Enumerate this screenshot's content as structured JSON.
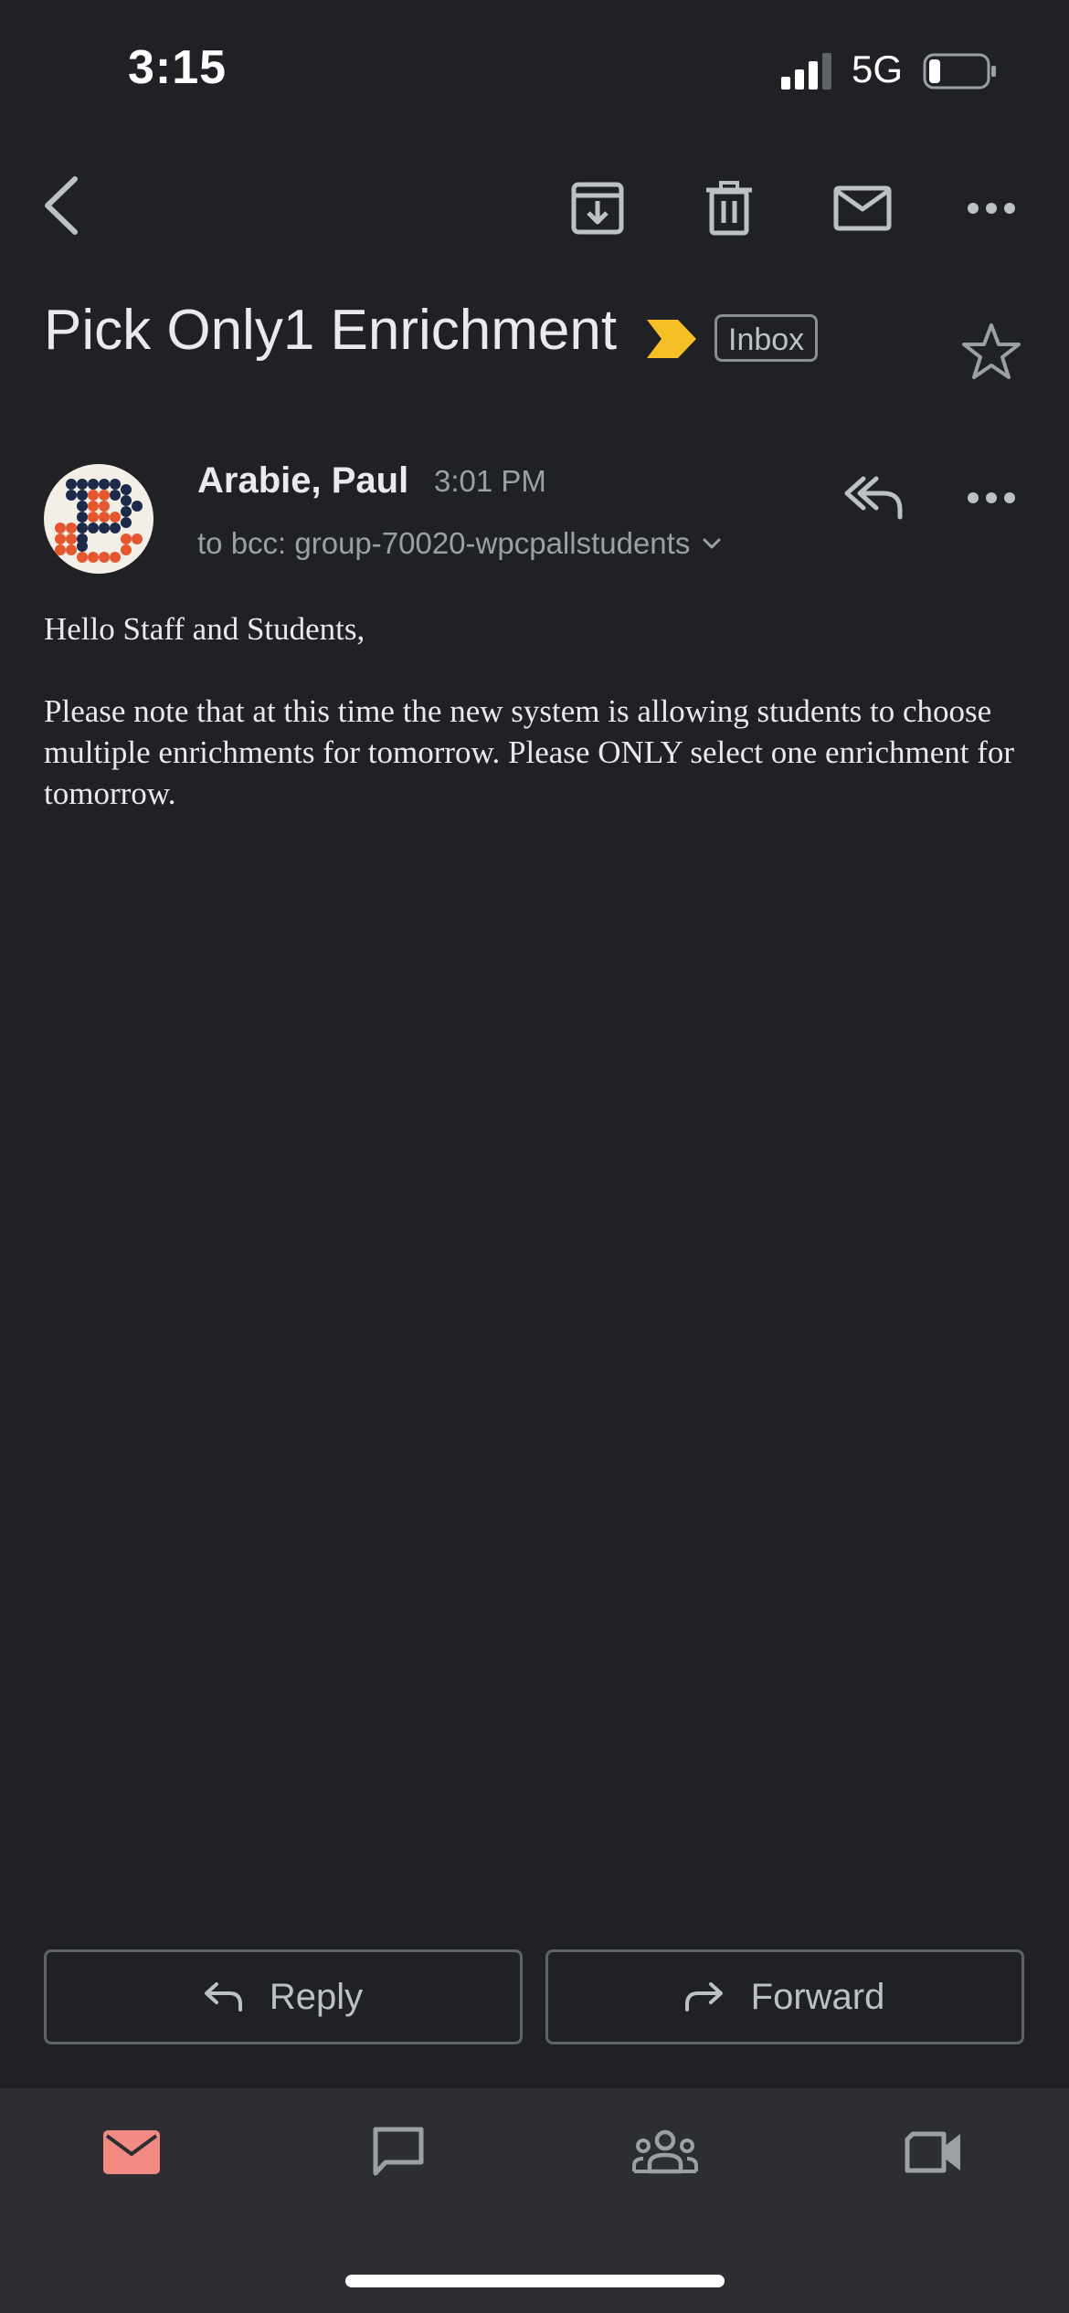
{
  "status_bar": {
    "time": "3:15",
    "network": "5G",
    "battery_level": 0.2
  },
  "toolbar": {
    "back_icon": "chevron-left-icon",
    "archive_icon": "archive-icon",
    "delete_icon": "trash-icon",
    "mark_unread_icon": "mail-icon",
    "more_icon": "more-horizontal-icon"
  },
  "email": {
    "subject": "Pick Only1 Enrichment",
    "label": "Inbox",
    "important": true,
    "starred": false,
    "sender_name": "Arabie, Paul",
    "sent_time": "3:01 PM",
    "recipients": "to bcc: group-70020-wpcpallstudents",
    "body": [
      "Hello Staff and Students,",
      "Please note that at this time the new system is allowing students to choose multiple enrichments for tomorrow.  Please ONLY select one enrichment for tomorrow."
    ]
  },
  "actions": {
    "reply_label": "Reply",
    "forward_label": "Forward"
  },
  "bottom_nav": {
    "items": [
      {
        "name": "mail",
        "icon": "mail-icon",
        "active": true
      },
      {
        "name": "chat",
        "icon": "chat-icon",
        "active": false
      },
      {
        "name": "spaces",
        "icon": "people-icon",
        "active": false
      },
      {
        "name": "meet",
        "icon": "video-icon",
        "active": false
      }
    ]
  },
  "colors": {
    "background": "#202124",
    "bottom_nav_background": "#2d2e31",
    "active_nav": "#f28b82",
    "importance": "#f6bf26",
    "text_primary": "#e8eaed",
    "text_secondary": "#9aa0a6"
  }
}
